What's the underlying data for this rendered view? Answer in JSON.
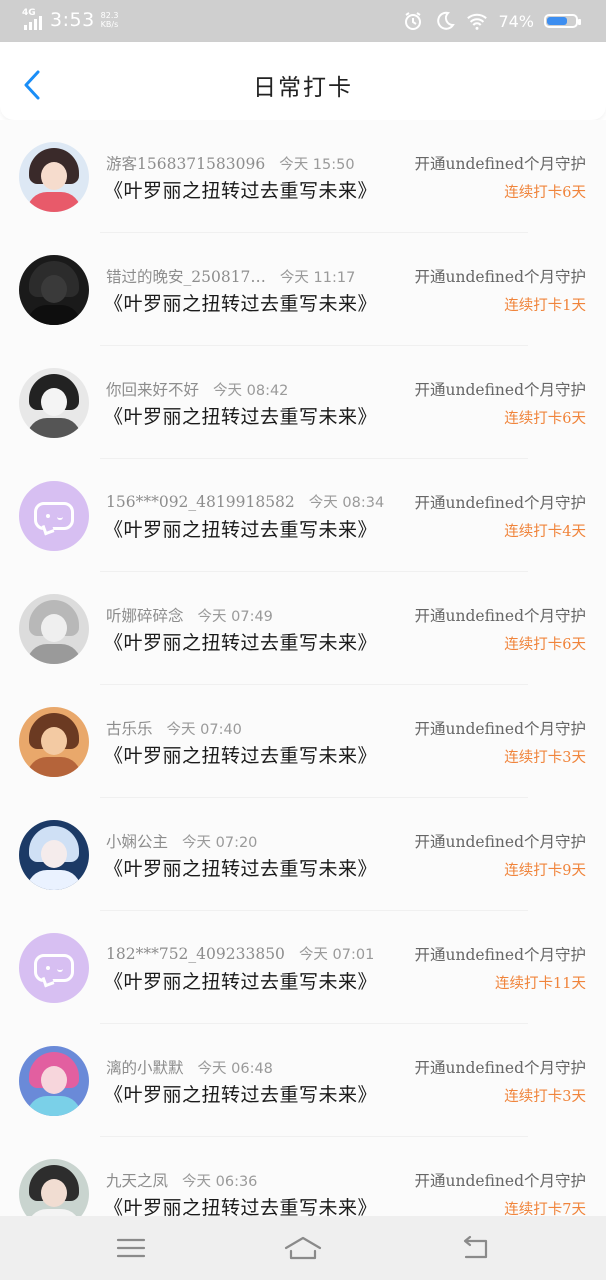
{
  "status_bar": {
    "network": "4G",
    "time": "3:53",
    "speed_value": "82.3",
    "speed_unit": "KB/s",
    "battery_percent": "74%",
    "battery_level": 0.74
  },
  "header": {
    "title": "日常打卡",
    "back_icon": "chevron-left-icon"
  },
  "colors": {
    "accent_blue": "#1a8ef7",
    "streak_orange": "#f0843b",
    "default_avatar": "#d7bff2"
  },
  "entries": [
    {
      "user": "游客1568371583096",
      "time": "今天 15:50",
      "guard": "开通undefined个月守护",
      "book": "《叶罗丽之扭转过去重写未来》",
      "streak": "连续打卡6天",
      "avatar": "anime-girl-avatar"
    },
    {
      "user": "错过的晚安_250817…",
      "time": "今天 11:17",
      "guard": "开通undefined个月守护",
      "book": "《叶罗丽之扭转过去重写未来》",
      "streak": "连续打卡1天",
      "avatar": "dark-photo-avatar"
    },
    {
      "user": "你回来好不好",
      "time": "今天 08:42",
      "guard": "开通undefined个月守护",
      "book": "《叶罗丽之扭转过去重写未来》",
      "streak": "连续打卡6天",
      "avatar": "manga-avatar"
    },
    {
      "user": "156***092_4819918582",
      "time": "今天 08:34",
      "guard": "开通undefined个月守护",
      "book": "《叶罗丽之扭转过去重写未来》",
      "streak": "连续打卡4天",
      "avatar": "default-chat-avatar"
    },
    {
      "user": "听娜碎碎念",
      "time": "今天 07:49",
      "guard": "开通undefined个月守护",
      "book": "《叶罗丽之扭转过去重写未来》",
      "streak": "连续打卡6天",
      "avatar": "sketch-girl-avatar"
    },
    {
      "user": "古乐乐",
      "time": "今天 07:40",
      "guard": "开通undefined个月守护",
      "book": "《叶罗丽之扭转过去重写未来》",
      "streak": "连续打卡3天",
      "avatar": "warm-girl-avatar"
    },
    {
      "user": "小娴公主",
      "time": "今天 07:20",
      "guard": "开通undefined个月守护",
      "book": "《叶罗丽之扭转过去重写未来》",
      "streak": "连续打卡9天",
      "avatar": "fairy-avatar"
    },
    {
      "user": "182***752_409233850",
      "time": "今天 07:01",
      "guard": "开通undefined个月守护",
      "book": "《叶罗丽之扭转过去重写未来》",
      "streak": "连续打卡11天",
      "avatar": "default-chat-avatar"
    },
    {
      "user": "漓的小默默",
      "time": "今天 06:48",
      "guard": "开通undefined个月守护",
      "book": "《叶罗丽之扭转过去重写未来》",
      "streak": "连续打卡3天",
      "avatar": "colorful-anime-avatar"
    },
    {
      "user": "九天之凤",
      "time": "今天 06:36",
      "guard": "开通undefined个月守护",
      "book": "《叶罗丽之扭转过去重写未来》",
      "streak": "连续打卡7天",
      "avatar": "white-dress-avatar"
    }
  ],
  "nav_bar": {
    "menu_icon": "menu-icon",
    "home_icon": "home-icon",
    "back_icon": "back-arrow-icon"
  }
}
